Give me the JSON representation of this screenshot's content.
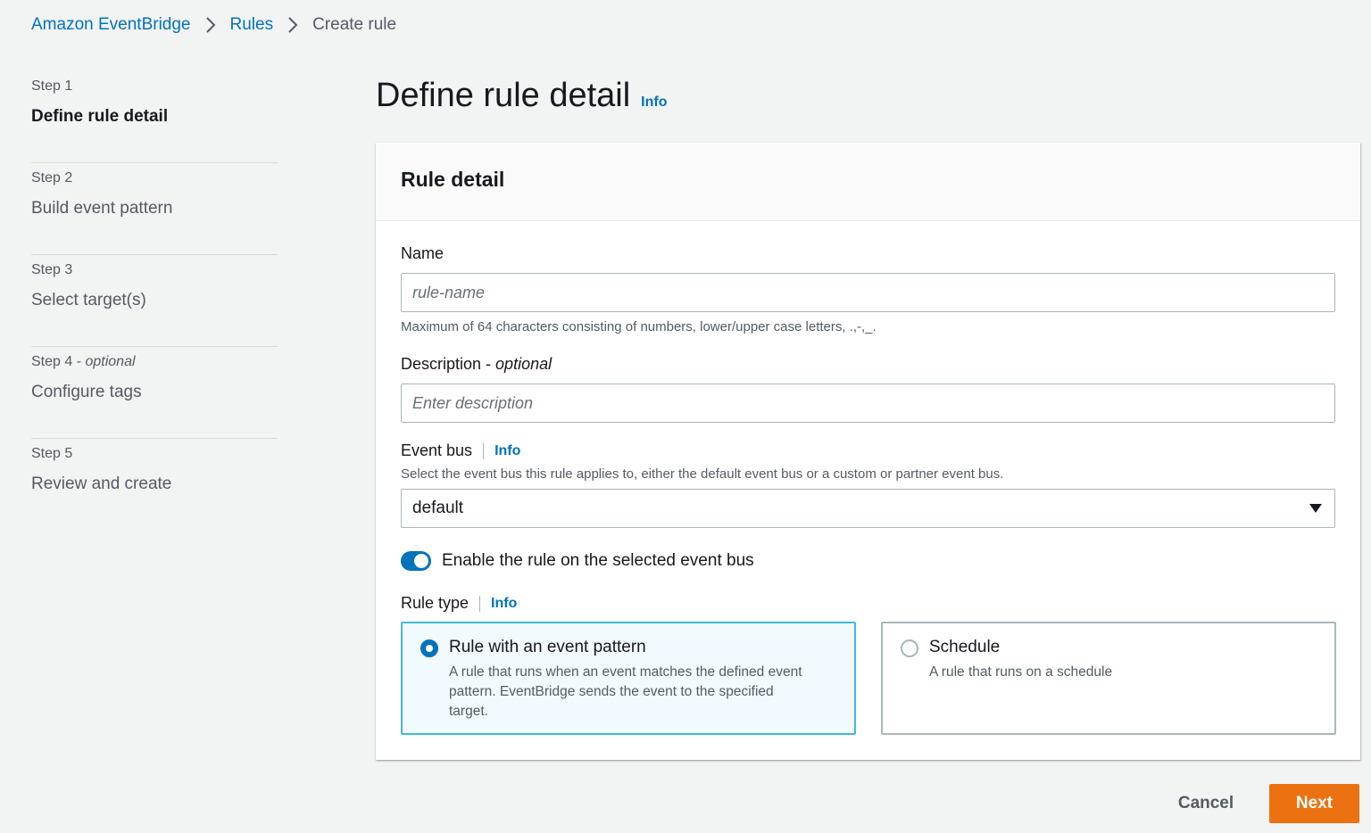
{
  "breadcrumb": {
    "items": [
      "Amazon EventBridge",
      "Rules"
    ],
    "current": "Create rule"
  },
  "steps": [
    {
      "label": "Step 1",
      "optional": "",
      "title": "Define rule detail",
      "active": true
    },
    {
      "label": "Step 2",
      "optional": "",
      "title": "Build event pattern",
      "active": false
    },
    {
      "label": "Step 3",
      "optional": "",
      "title": "Select target(s)",
      "active": false
    },
    {
      "label": "Step 4 - ",
      "optional": "optional",
      "title": "Configure tags",
      "active": false
    },
    {
      "label": "Step 5",
      "optional": "",
      "title": "Review and create",
      "active": false
    }
  ],
  "page": {
    "title": "Define rule detail",
    "info": "Info"
  },
  "container": {
    "title": "Rule detail"
  },
  "name_field": {
    "label": "Name",
    "placeholder": "rule-name",
    "value": "",
    "hint": "Maximum of 64 characters consisting of numbers, lower/upper case letters, .,-,_."
  },
  "description_field": {
    "label": "Description - ",
    "optional": "optional",
    "placeholder": "Enter description",
    "value": ""
  },
  "event_bus": {
    "label": "Event bus",
    "info": "Info",
    "hint": "Select the event bus this rule applies to, either the default event bus or a custom or partner event bus.",
    "selected": "default"
  },
  "enable_toggle": {
    "label": "Enable the rule on the selected event bus",
    "checked": true
  },
  "rule_type": {
    "label": "Rule type",
    "info": "Info",
    "options": [
      {
        "title": "Rule with an event pattern",
        "description": "A rule that runs when an event matches the defined event pattern. EventBridge sends the event to the specified target.",
        "selected": true
      },
      {
        "title": "Schedule",
        "description": "A rule that runs on a schedule",
        "selected": false
      }
    ]
  },
  "actions": {
    "cancel": "Cancel",
    "next": "Next"
  },
  "colors": {
    "link": "#0073bb",
    "primary_button": "#ec7211",
    "selected_tile_border": "#44b9d6",
    "selected_tile_bg": "#f1faff"
  }
}
